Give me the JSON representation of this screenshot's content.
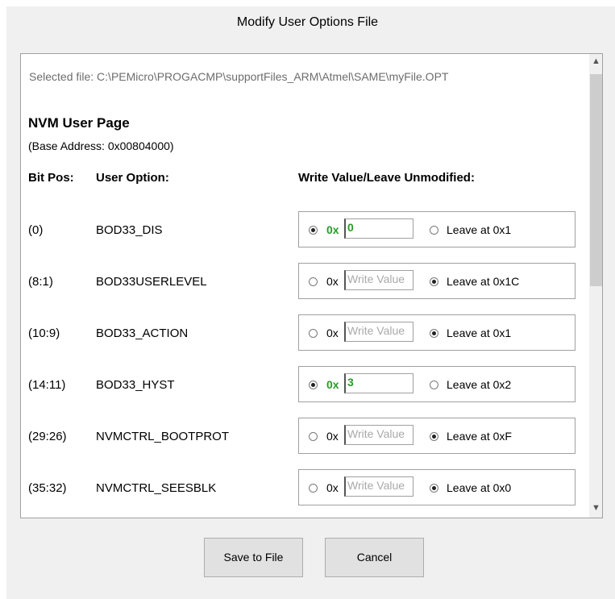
{
  "dialog": {
    "title": "Modify User Options File",
    "selected_file": "Selected file: C:\\PEMicro\\PROGACMP\\supportFiles_ARM\\Atmel\\SAME\\myFile.OPT",
    "section_title": "NVM User Page",
    "base_address": "(Base Address: 0x00804000)",
    "headers": {
      "bit_pos": "Bit Pos:",
      "user_option": "User Option:",
      "write_value": "Write Value/Leave Unmodified:"
    },
    "hex_prefix": "0x",
    "rows": [
      {
        "bit": "(0)",
        "name": "BOD33_DIS",
        "write_checked": true,
        "value": "0",
        "placeholder": "",
        "leave": "Leave at 0x1"
      },
      {
        "bit": "(8:1)",
        "name": "BOD33USERLEVEL",
        "write_checked": false,
        "value": "",
        "placeholder": "Write Value",
        "leave": "Leave at 0x1C"
      },
      {
        "bit": "(10:9)",
        "name": "BOD33_ACTION",
        "write_checked": false,
        "value": "",
        "placeholder": "Write Value",
        "leave": "Leave at 0x1"
      },
      {
        "bit": "(14:11)",
        "name": "BOD33_HYST",
        "write_checked": true,
        "value": "3",
        "placeholder": "",
        "leave": "Leave at 0x2"
      },
      {
        "bit": "(29:26)",
        "name": "NVMCTRL_BOOTPROT",
        "write_checked": false,
        "value": "",
        "placeholder": "Write Value",
        "leave": "Leave at 0xF"
      },
      {
        "bit": "(35:32)",
        "name": "NVMCTRL_SEESBLK",
        "write_checked": false,
        "value": "",
        "placeholder": "Write Value",
        "leave": "Leave at 0x0"
      }
    ],
    "buttons": {
      "save": "Save to File",
      "cancel": "Cancel"
    },
    "scroll_up_icon": "▲",
    "scroll_down_icon": "▼"
  }
}
